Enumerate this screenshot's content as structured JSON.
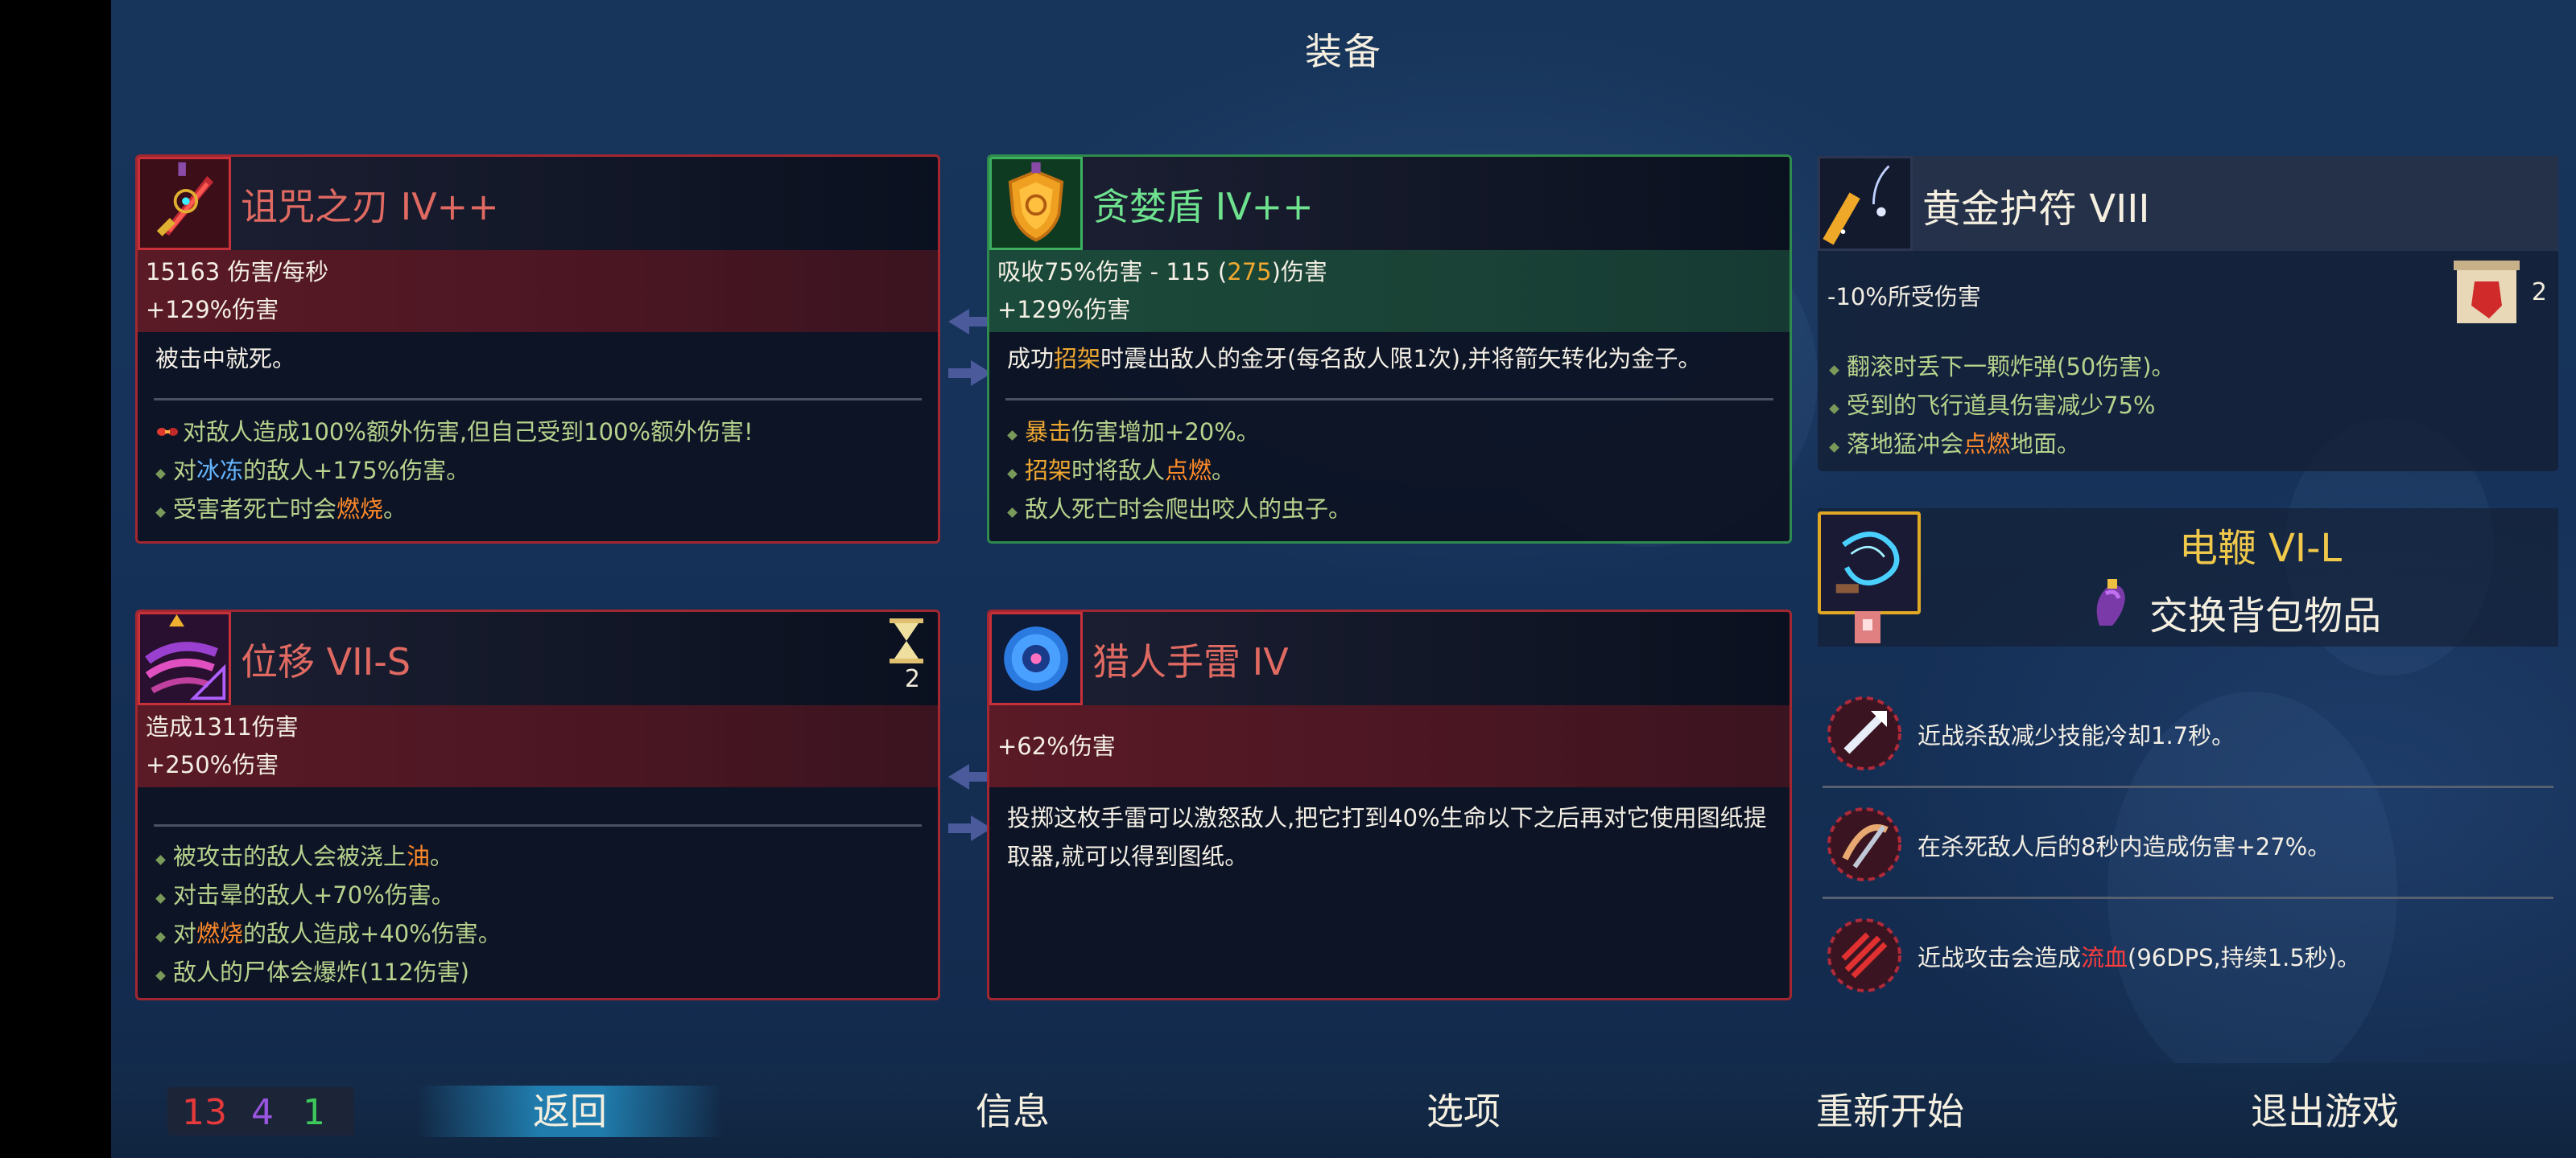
{
  "title": "装备",
  "weapon1": {
    "name": "诅咒之刃 IV++",
    "stats": [
      "15163 伤害/每秒",
      "+129%伤害"
    ],
    "description": "被击中就死。",
    "affixes": [
      {
        "parts": [
          {
            "t": "对敌人造成100%额外伤害,但自己受到100%额外伤害!"
          }
        ]
      },
      {
        "parts": [
          {
            "t": "对"
          },
          {
            "t": "冰冻",
            "c": "hl-b"
          },
          {
            "t": "的敌人+175%伤害。"
          }
        ]
      },
      {
        "parts": [
          {
            "t": "受害者死亡时会"
          },
          {
            "t": "燃烧",
            "c": "hl-o"
          },
          {
            "t": "。"
          }
        ]
      }
    ]
  },
  "weapon2": {
    "name": "贪婪盾 IV++",
    "stats_parts": [
      {
        "t": "吸收75%伤害 - 115 ("
      },
      {
        "t": "275",
        "c": "hl-y"
      },
      {
        "t": ")伤害"
      }
    ],
    "stat2": "+129%伤害",
    "description_parts": [
      {
        "t": "成功"
      },
      {
        "t": "招架",
        "c": "hl-y"
      },
      {
        "t": "时震出敌人的金牙(每名敌人限1次),并将箭矢转化为金子。"
      }
    ],
    "affixes": [
      {
        "parts": [
          {
            "t": "暴击",
            "c": "hl-y"
          },
          {
            "t": "伤害增加+20%。"
          }
        ]
      },
      {
        "parts": [
          {
            "t": "招架",
            "c": "hl-y"
          },
          {
            "t": "时将敌人"
          },
          {
            "t": "点燃",
            "c": "hl-o"
          },
          {
            "t": "。"
          }
        ]
      },
      {
        "parts": [
          {
            "t": "敌人死亡时会爬出咬人的虫子。"
          }
        ]
      }
    ]
  },
  "skill1": {
    "name": "位移 VII-S",
    "cooldown_count": "2",
    "stats": [
      "造成1311伤害",
      "+250%伤害"
    ],
    "affixes": [
      {
        "parts": [
          {
            "t": "被攻击的敌人会被浇上"
          },
          {
            "t": "油",
            "c": "hl-o"
          },
          {
            "t": "。"
          }
        ]
      },
      {
        "parts": [
          {
            "t": "对击晕的敌人+70%伤害。"
          }
        ]
      },
      {
        "parts": [
          {
            "t": "对"
          },
          {
            "t": "燃烧",
            "c": "hl-o"
          },
          {
            "t": "的敌人造成+40%伤害。"
          }
        ]
      },
      {
        "parts": [
          {
            "t": "敌人的尸体会爆炸(112伤害)"
          }
        ]
      }
    ]
  },
  "skill2": {
    "name": "猎人手雷 IV",
    "stats": [
      "+62%伤害"
    ],
    "description": "投掷这枚手雷可以激怒敌人,把它打到40%生命以下之后再对它使用图纸提取器,就可以得到图纸。"
  },
  "amulet": {
    "name": "黄金护符 VIII",
    "stat": "-10%所受伤害",
    "scroll_count": "2",
    "affixes": [
      {
        "parts": [
          {
            "t": "翻滚时丢下一颗炸弹(50伤害)。"
          }
        ]
      },
      {
        "parts": [
          {
            "t": "受到的飞行道具伤害减少75%"
          }
        ]
      },
      {
        "parts": [
          {
            "t": "落地猛冲会"
          },
          {
            "t": "点燃",
            "c": "hl-o"
          },
          {
            "t": "地面。"
          }
        ]
      }
    ]
  },
  "backpack": {
    "name": "电鞭 VI-L",
    "swap_label": "交换背包物品"
  },
  "mutations": [
    {
      "parts": [
        {
          "t": "近战杀敌减少技能冷却1.7秒。"
        }
      ]
    },
    {
      "parts": [
        {
          "t": "在杀死敌人后的8秒内造成伤害+27%。"
        }
      ]
    },
    {
      "parts": [
        {
          "t": "近战攻击会造成"
        },
        {
          "t": "流血",
          "c": "hl-r"
        },
        {
          "t": "(96DPS,持续1.5秒)。"
        }
      ]
    }
  ],
  "scroll_counts": {
    "brutality": {
      "value": "13",
      "color": "#e5393b"
    },
    "tactics": {
      "value": "4",
      "color": "#9a55e0"
    },
    "survival": {
      "value": "1",
      "color": "#3ec95a"
    }
  },
  "nav": {
    "back": "返回",
    "info": "信息",
    "options": "选项",
    "restart": "重新开始",
    "quit": "退出游戏"
  },
  "icons": [
    "cursed-sword-icon",
    "greed-shield-icon",
    "shift-skill-icon",
    "hunter-grenade-icon",
    "gold-amulet-icon",
    "electric-whip-icon",
    "swap-backpack-icon",
    "power-scroll-icon",
    "hourglass-icon",
    "mutation-icons"
  ]
}
